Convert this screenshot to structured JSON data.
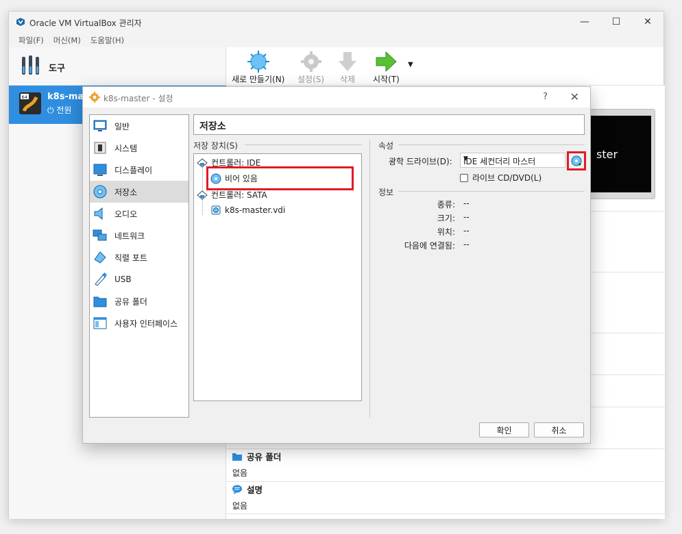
{
  "window": {
    "title": "Oracle VM VirtualBox 관리자",
    "minimize": "—",
    "maximize": "☐",
    "close": "✕"
  },
  "menu": [
    "파일(F)",
    "머신(M)",
    "도움말(H)"
  ],
  "left": {
    "tools_label": "도구",
    "vm_name": "k8s-ma",
    "vm_state": "전원"
  },
  "toolbar": {
    "new": "새로 만들기(N)",
    "settings": "설정(S)",
    "delete": "삭제",
    "start": "시작(T)"
  },
  "preview_text": "ster",
  "details": {
    "shared_title": "공유 폴더",
    "shared_value": "없음",
    "desc_title": "설명",
    "desc_value": "없음"
  },
  "dialog": {
    "title": "k8s-master - 설정",
    "help": "?",
    "close": "✕",
    "categories": [
      "일반",
      "시스템",
      "디스플레이",
      "저장소",
      "오디오",
      "네트워크",
      "직렬 포트",
      "USB",
      "공유 폴더",
      "사용자 인터페이스"
    ],
    "page_title": "저장소",
    "storage_label": "저장 장치(S)",
    "tree": {
      "ide_controller": "컨트롤러: IDE",
      "ide_item": "비어 있음",
      "sata_controller": "컨트롤러: SATA",
      "sata_item": "k8s-master.vdi"
    },
    "attributes_label": "속성",
    "optical_label": "광학 드라이브(D):",
    "optical_value": "IDE 세컨더리 마스터",
    "live_cd": "라이브 CD/DVD(L)",
    "info_label": "정보",
    "info": [
      {
        "key": "종류:",
        "value": "--"
      },
      {
        "key": "크기:",
        "value": "--"
      },
      {
        "key": "위치:",
        "value": "--"
      },
      {
        "key": "다음에 연결됨:",
        "value": "--"
      }
    ],
    "ok": "확인",
    "cancel": "취소"
  },
  "colors": {
    "accent": "#2f8ee0",
    "highlight": "#e01b24"
  }
}
